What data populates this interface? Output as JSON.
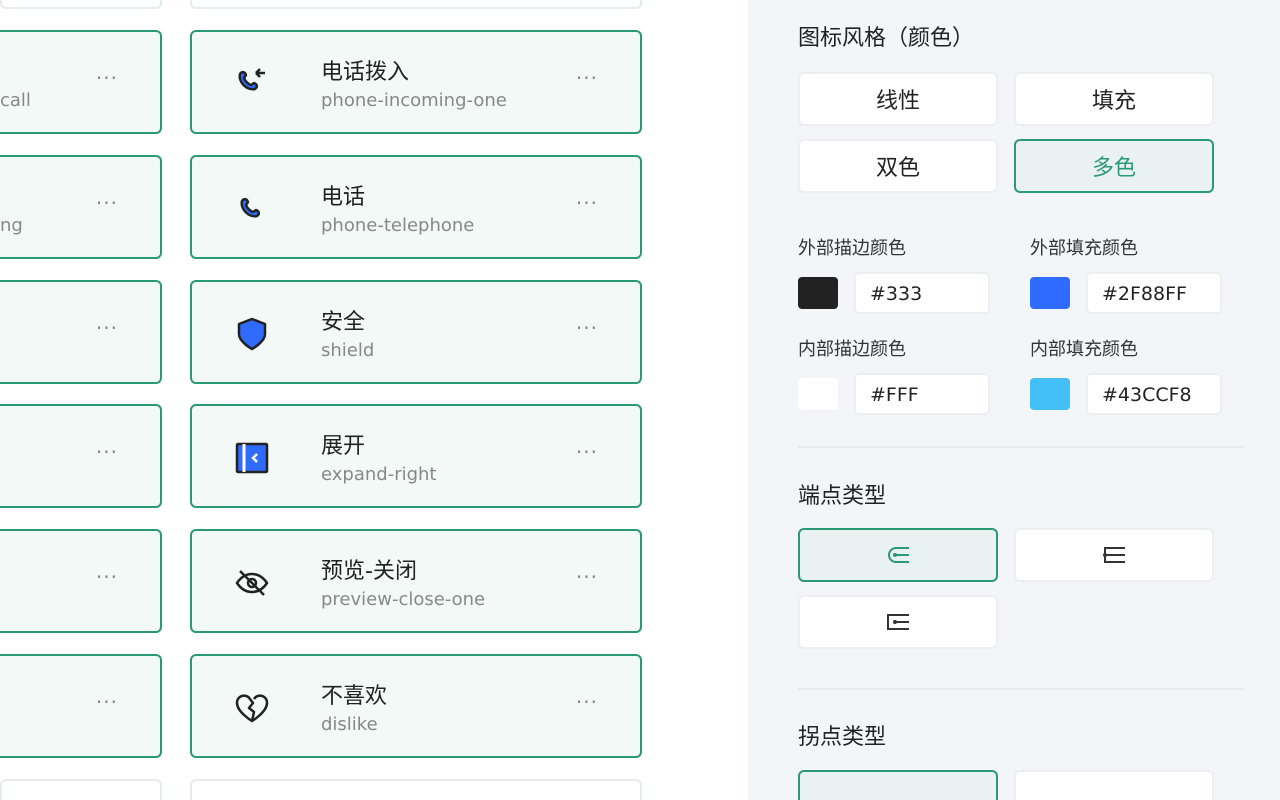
{
  "left_cards": [
    {
      "en": "call"
    },
    {
      "en": "ng"
    },
    {
      "en": ""
    },
    {
      "en": ""
    },
    {
      "en": ""
    },
    {
      "en": ""
    }
  ],
  "cards": [
    {
      "zh": "电话拨入",
      "en": "phone-incoming-one",
      "icon": "phone-incoming-icon"
    },
    {
      "zh": "电话",
      "en": "phone-telephone",
      "icon": "phone-icon"
    },
    {
      "zh": "安全",
      "en": "shield",
      "icon": "shield-icon"
    },
    {
      "zh": "展开",
      "en": "expand-right",
      "icon": "expand-right-icon"
    },
    {
      "zh": "预览-关闭",
      "en": "preview-close-one",
      "icon": "eye-off-icon"
    },
    {
      "zh": "不喜欢",
      "en": "dislike",
      "icon": "broken-heart-icon"
    }
  ],
  "more": "···",
  "panel": {
    "style_title": "图标风格（颜色）",
    "styles": [
      "线性",
      "填充",
      "双色",
      "多色"
    ],
    "selected_style": "多色",
    "colors": [
      {
        "label": "外部描边颜色",
        "value": "#333",
        "swatch": "#222222"
      },
      {
        "label": "外部填充颜色",
        "value": "#2F88FF",
        "swatch": "#2F6BFF"
      },
      {
        "label": "内部描边颜色",
        "value": "#FFF",
        "swatch": "#FFFFFF"
      },
      {
        "label": "内部填充颜色",
        "value": "#43CCF8",
        "swatch": "#43C0F8"
      }
    ],
    "endpoint_title": "端点类型",
    "corner_title": "拐点类型"
  },
  "accent": "#2a9a74"
}
